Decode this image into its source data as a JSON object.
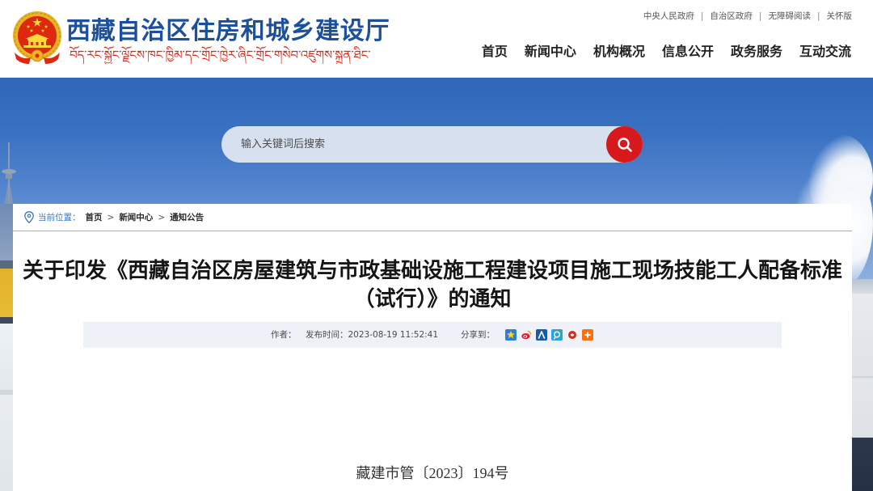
{
  "site": {
    "title": "西藏自治区住房和城乡建设厅",
    "title_tibetan": "བོད་རང་སྐྱོང་ལྗོངས་ཁང་ཁྱིམ་དང་གྲོང་ཁྱེར་ཞིང་གྲོང་གསེབ་འཛུགས་སྐྲུན་ཐིང་།",
    "emblem_icon": "national-emblem-icon"
  },
  "top_links": {
    "items": [
      "中央人民政府",
      "自治区政府",
      "无障碍阅读",
      "关怀版"
    ],
    "separator": "|"
  },
  "nav": {
    "items": [
      "首页",
      "新闻中心",
      "机构概况",
      "信息公开",
      "政务服务",
      "互动交流"
    ]
  },
  "search": {
    "placeholder": "输入关键词后搜索",
    "button_icon": "search-icon"
  },
  "breadcrumb": {
    "icon": "location-pin-icon",
    "label": "当前位置：",
    "separator": ">",
    "items": [
      "首页",
      "新闻中心",
      "通知公告"
    ]
  },
  "article": {
    "title": "关于印发《西藏自治区房屋建筑与市政基础设施工程建设项目施工现场技能工人配备标准（试行）》的通知",
    "meta": {
      "author_label": "作者：",
      "publish_label": "发布时间：",
      "publish_time": "2023-08-19 11:52:41",
      "share_label": "分享到：",
      "share_icons": [
        "qzone-share-icon",
        "weibo-share-icon",
        "renren-share-icon",
        "tencent-weibo-share-icon",
        "people-weibo-share-icon",
        "more-share-icon"
      ]
    },
    "doc_number": "藏建市管〔2023〕194号"
  },
  "colors": {
    "site_title": "#1c4f9c",
    "tibetan_title": "#d42b1e",
    "search_button": "#d7191d",
    "breadcrumb_label": "#3a78c3",
    "breadcrumb_rule": "#8fb2e0",
    "meta_bar_bg": "#eef2f8",
    "banner_sky": "#2f67b8"
  }
}
